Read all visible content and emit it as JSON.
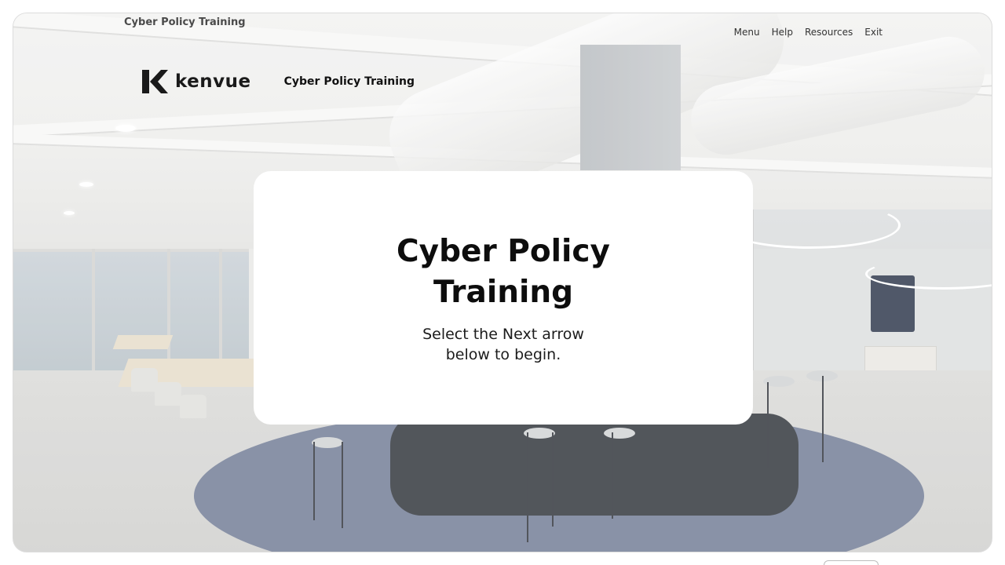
{
  "header": {
    "course_title": "Cyber Policy Training"
  },
  "nav": {
    "items": [
      {
        "label": "Menu"
      },
      {
        "label": "Help"
      },
      {
        "label": "Resources"
      },
      {
        "label": "Exit"
      }
    ]
  },
  "brand": {
    "logo_text": "kenvue",
    "logo_icon": "kenvue-k-logo",
    "title": "Cyber Policy Training"
  },
  "card": {
    "title": "Cyber Policy Training",
    "subtitle": "Select the Next arrow below to begin."
  },
  "colors": {
    "card_bg": "#ffffff",
    "text_dark": "#0d0d0d",
    "rug_blue": "#6f7a94"
  }
}
